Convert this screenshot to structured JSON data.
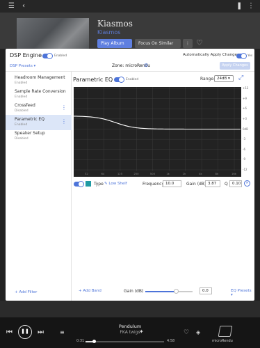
{
  "app": {
    "back_icon": "back-arrow",
    "album": {
      "title": "Kiasmos",
      "artist": "Kiasmos",
      "play_label": "Play Album",
      "focus_label": "Focus On Similar",
      "more_label": "⋮"
    }
  },
  "dsp": {
    "title": "DSP Engine",
    "enabled_label": "Enabled",
    "auto_apply_label": "Automatically Apply Changes",
    "auto_apply_value": "Yes",
    "presets_label": "DSP Presets",
    "zone_label": "Zone:",
    "zone_name": "microRendu",
    "apply_label": "Apply Changes",
    "filters": [
      {
        "name": "Headroom Management",
        "status": "Enabled"
      },
      {
        "name": "Sample Rate Conversion",
        "status": "Enabled"
      },
      {
        "name": "Crossfeed",
        "status": "Disabled"
      },
      {
        "name": "Parametric EQ",
        "status": "Enabled"
      },
      {
        "name": "Speaker Setup",
        "status": "Disabled"
      }
    ],
    "add_filter_label": "Add Filter"
  },
  "eq": {
    "title": "Parametric EQ",
    "enabled_label": "Enabled",
    "range_label": "Range:",
    "range_value": "24dB",
    "db_ticks": [
      "+12",
      "+9",
      "+6",
      "+3",
      "0dB",
      "-3",
      "-6",
      "-9",
      "-12"
    ],
    "freq_ticks": [
      "32",
      "64",
      "125",
      "250",
      "500",
      "1k",
      "2k",
      "4k",
      "8k",
      "16k"
    ],
    "band": {
      "type_label": "Type",
      "type_value": "Low Shelf",
      "frequency_label": "Frequency",
      "frequency_value": "10.0",
      "gain_label": "Gain (dB)",
      "gain_value": "3.87",
      "q_label": "Q",
      "q_value": "0.10",
      "color": "#1f9aa3"
    },
    "add_band_label": "Add Band",
    "gain_label": "Gain (dB)",
    "gain_value": "0.0",
    "gain_level": 0.65,
    "presets_label": "EQ Presets"
  },
  "player": {
    "track_title": "Pendulum",
    "track_artist": "FKA twigs",
    "current_time": "0:31",
    "duration": "4:58",
    "progress": 0.11,
    "zone": "microRendu"
  },
  "colors": {
    "accent": "#4d74d9",
    "graph_bg": "#222222"
  }
}
